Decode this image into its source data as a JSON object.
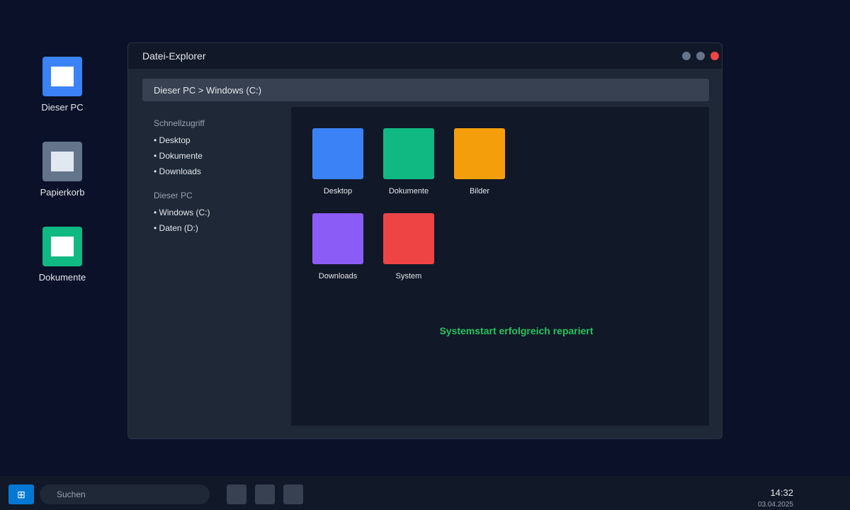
{
  "desktop": {
    "icons": [
      {
        "label": "Dieser PC",
        "color": "#3b82f6"
      },
      {
        "label": "Papierkorb",
        "color": "#64748b"
      },
      {
        "label": "Dokumente",
        "color": "#10b981"
      }
    ]
  },
  "window": {
    "title": "Datei-Explorer",
    "address": "Dieser PC > Windows (C:)",
    "sidebar": {
      "quick_access_label": "Schnellzugriff",
      "quick_access": [
        "• Desktop",
        "• Dokumente",
        "• Downloads"
      ],
      "this_pc_label": "Dieser PC",
      "drives": [
        "• Windows (C:)",
        "• Daten (D:)"
      ]
    },
    "folders": [
      {
        "label": "Desktop",
        "color": "#3b82f6"
      },
      {
        "label": "Dokumente",
        "color": "#10b981"
      },
      {
        "label": "Bilder",
        "color": "#f59e0b"
      },
      {
        "label": "Downloads",
        "color": "#8b5cf6"
      },
      {
        "label": "System",
        "color": "#ef4444"
      }
    ],
    "status_message": "Systemstart erfolgreich repariert",
    "status_color": "#22c55e"
  },
  "taskbar": {
    "start_icon": "windows-icon",
    "start_glyph": "⊞",
    "search_placeholder": "Suchen",
    "time": "14:32",
    "date": "03.04.2025"
  }
}
